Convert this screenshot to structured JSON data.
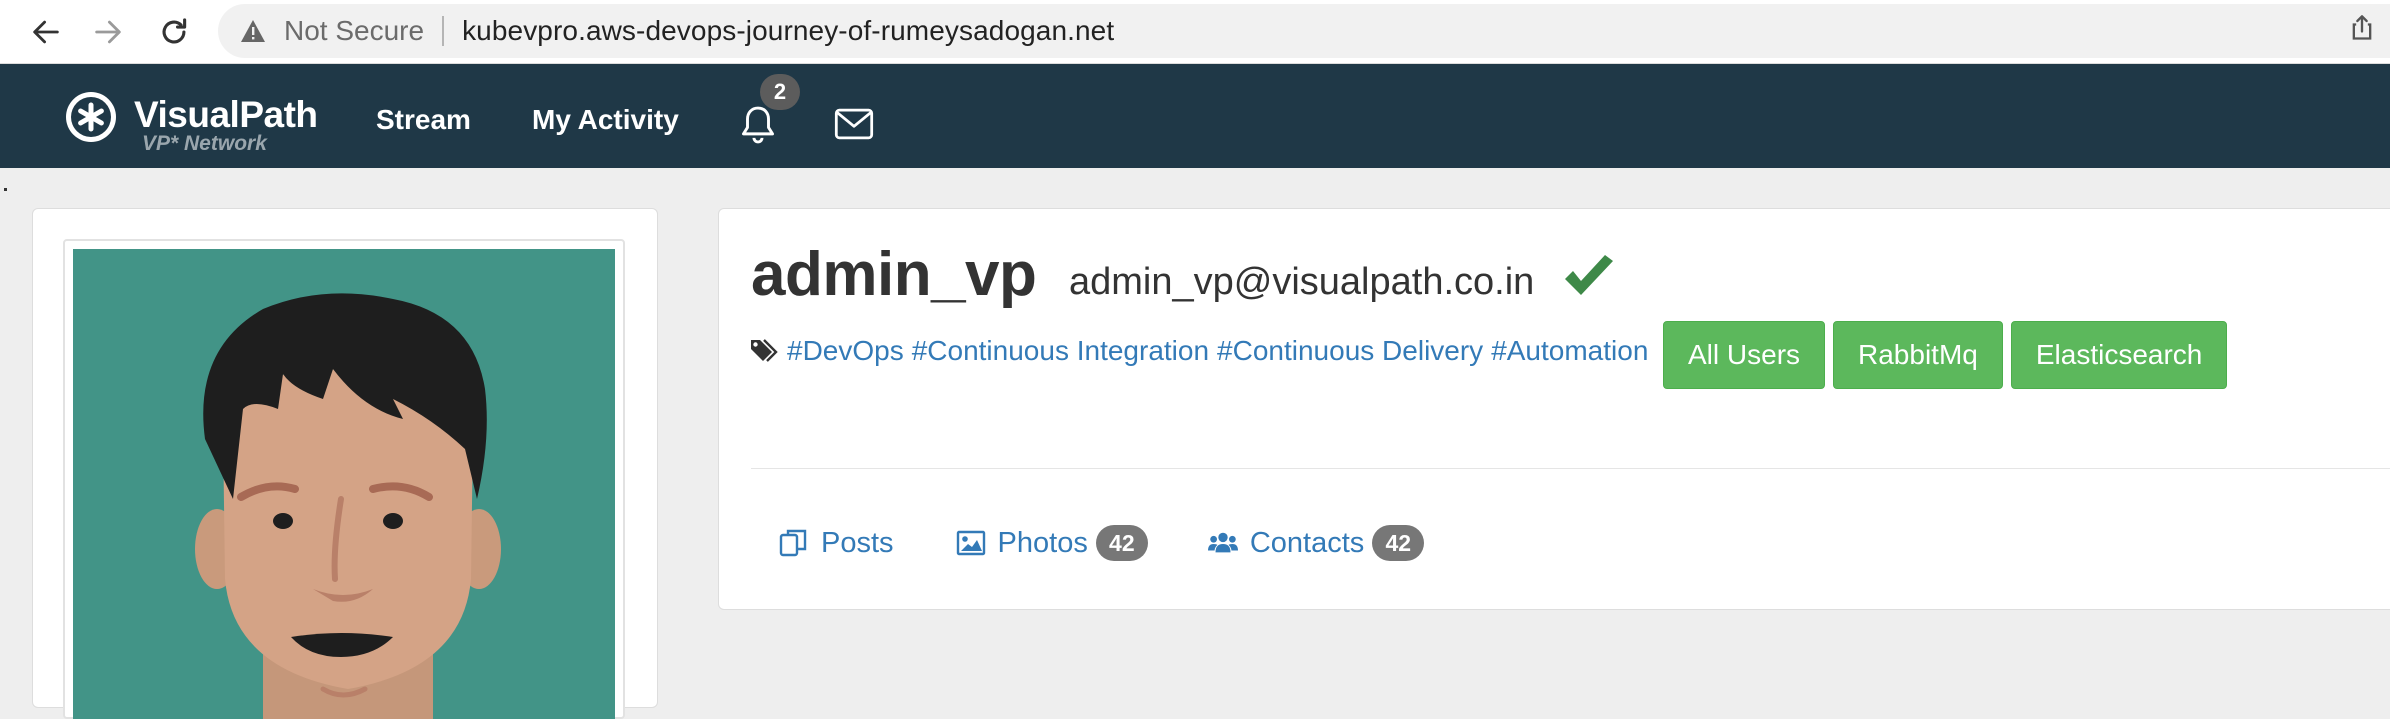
{
  "browser": {
    "security_label": "Not Secure",
    "url": "kubevpro.aws-devops-journey-of-rumeysadogan.net"
  },
  "navbar": {
    "brand": "VisualPath",
    "brand_sub": "VP* Network",
    "links": [
      "Stream",
      "My Activity"
    ],
    "notification_count": "2"
  },
  "profile": {
    "username": "admin_vp",
    "email": "admin_vp@visualpath.co.in",
    "tags": [
      "#DevOps",
      "#Continuous Integration",
      "#Continuous Delivery",
      "#Automation"
    ],
    "groups": [
      "All Users",
      "RabbitMq",
      "Elasticsearch"
    ],
    "tabs": [
      {
        "label": "Posts",
        "icon": "posts-icon"
      },
      {
        "label": "Photos",
        "icon": "image-icon",
        "count": "42"
      },
      {
        "label": "Contacts",
        "icon": "users-icon",
        "count": "42"
      }
    ]
  },
  "colors": {
    "navbar_bg": "#1f3847",
    "link": "#337ab7",
    "success": "#5cb85c",
    "badge": "#777777",
    "avatar_bg": "#429487"
  }
}
